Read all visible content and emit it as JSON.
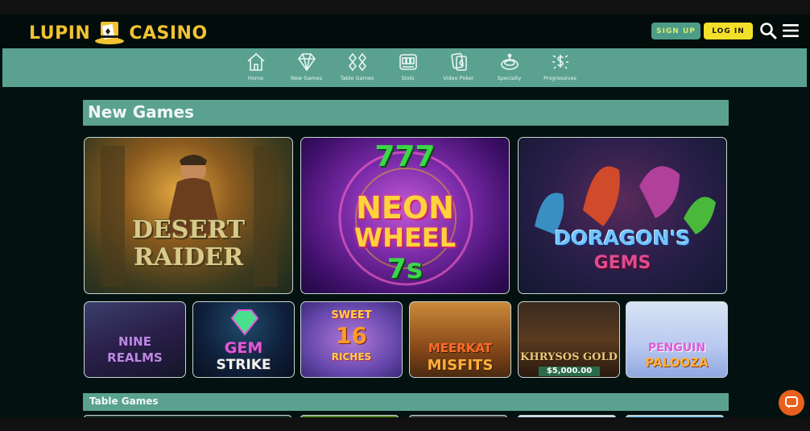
{
  "header": {
    "logo_left": "LUPIN",
    "logo_right": "CASINO",
    "signup_label": "SIGN UP",
    "login_label": "LOG IN",
    "search_icon": "search-icon",
    "menu_icon": "hamburger-menu-icon"
  },
  "nav": {
    "items": [
      {
        "label": "Home",
        "icon": "home-icon"
      },
      {
        "label": "New Games",
        "icon": "diamond-icon"
      },
      {
        "label": "Table Games",
        "icon": "cards-icon"
      },
      {
        "label": "Slots",
        "icon": "slot-machine-icon"
      },
      {
        "label": "Video Poker",
        "icon": "video-poker-icon"
      },
      {
        "label": "Specialty",
        "icon": "roulette-icon"
      },
      {
        "label": "Progressives",
        "icon": "dollar-burst-icon"
      }
    ]
  },
  "sections": {
    "new_games": "New Games",
    "table_games": "Table Games"
  },
  "games": {
    "featured": [
      {
        "title_line1": "DESERT",
        "title_line2": "RAIDER"
      },
      {
        "title_line1": "777",
        "title_line2": "NEON",
        "title_line3": "WHEEL",
        "title_line4": "7s"
      },
      {
        "title_line1": "DORAGON'S",
        "title_line2": "GEMS"
      }
    ],
    "small": [
      {
        "title_line1": "NINE",
        "title_line2": "REALMS"
      },
      {
        "title_line1": "GEM",
        "title_line2": "STRIKE"
      },
      {
        "title_line1": "SWEET",
        "title_line2": "16",
        "title_line3": "RICHES"
      },
      {
        "title_line1": "MEERKAT",
        "title_line2": "MISFITS"
      },
      {
        "title_line1": "KHRYSOS GOLD",
        "title_line2": "$5,000.00"
      },
      {
        "title_line1": "PENGUIN",
        "title_line2": "PALOOZA"
      }
    ]
  },
  "colors": {
    "accent_teal": "#5aa28f",
    "logo_gold": "#f1c232",
    "login_yellow": "#f3e02a",
    "chat_orange": "#e8601e"
  }
}
